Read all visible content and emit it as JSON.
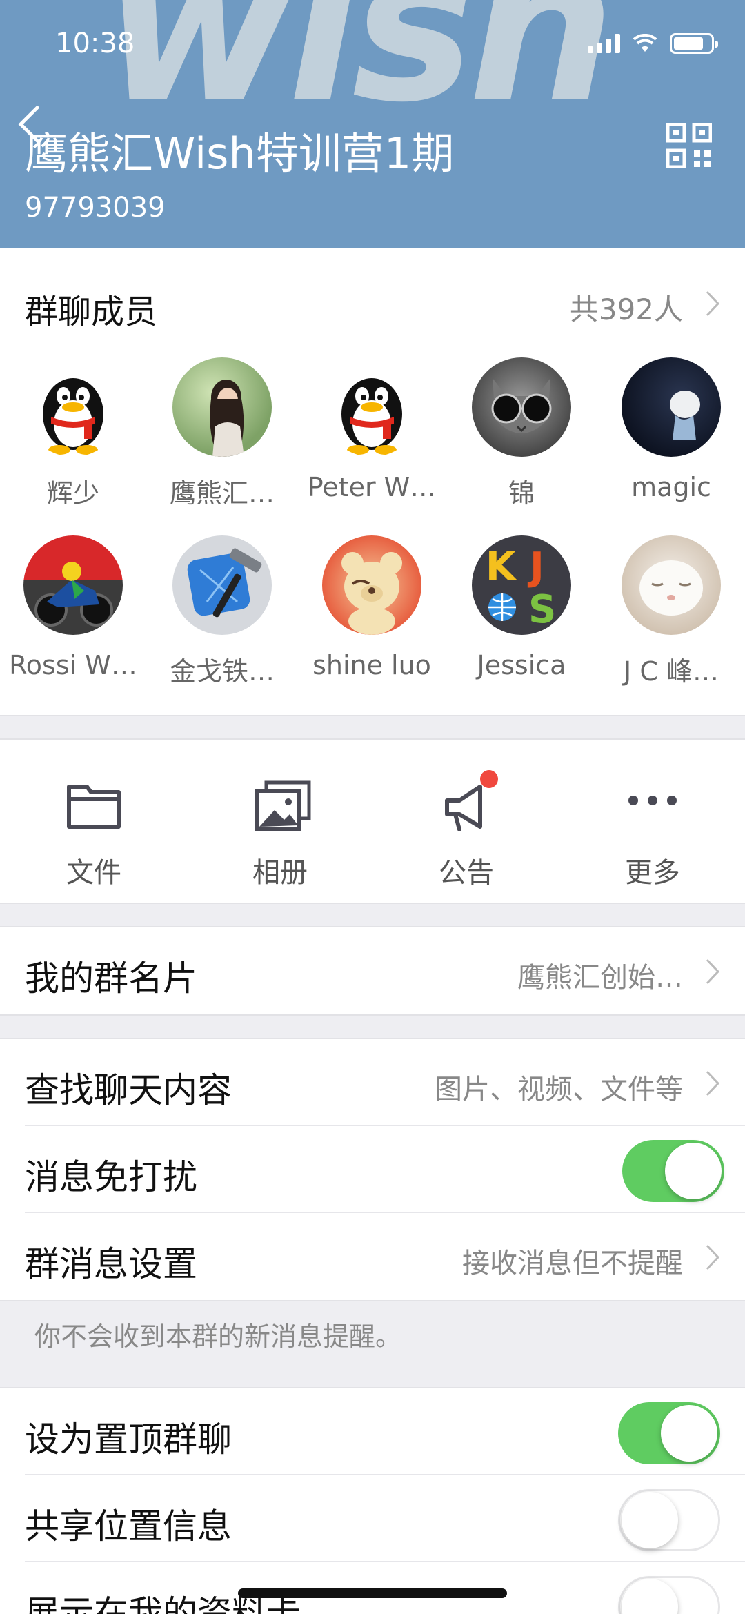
{
  "status_bar": {
    "time": "10:38"
  },
  "header": {
    "watermark": "wish",
    "title": "鹰熊汇Wish特训营1期",
    "group_id": "97793039"
  },
  "members": {
    "heading": "群聊成员",
    "count": "共392人",
    "list": [
      {
        "name": "辉少",
        "avatar": "qq-penguin"
      },
      {
        "name": "鹰熊汇…",
        "avatar": "photo-woman"
      },
      {
        "name": "Peter W…",
        "avatar": "qq-penguin"
      },
      {
        "name": "锦",
        "avatar": "cat-sunglasses"
      },
      {
        "name": "magic",
        "avatar": "photo-dark-figure"
      },
      {
        "name": "Rossi W…",
        "avatar": "motorcycle-rider"
      },
      {
        "name": "金戈铁…",
        "avatar": "xcode-hammer"
      },
      {
        "name": "shine luo",
        "avatar": "teddy-bear"
      },
      {
        "name": "Jessica",
        "avatar": "kjs-logo"
      },
      {
        "name": "J C 峰…",
        "avatar": "white-cat"
      }
    ]
  },
  "toolbar": [
    {
      "label": "文件",
      "icon": "folder-icon"
    },
    {
      "label": "相册",
      "icon": "photo-album-icon"
    },
    {
      "label": "公告",
      "icon": "megaphone-icon"
    },
    {
      "label": "更多",
      "icon": "more-dots-icon"
    }
  ],
  "settings": {
    "group_card": {
      "label": "我的群名片",
      "value": "鹰熊汇创始…"
    },
    "search_chat": {
      "label": "查找聊天内容",
      "value": "图片、视频、文件等"
    },
    "do_not_disturb": {
      "label": "消息免打扰",
      "on": true
    },
    "msg_settings": {
      "label": "群消息设置",
      "value": "接收消息但不提醒"
    },
    "hint": "你不会收到本群的新消息提醒。",
    "pin_chat": {
      "label": "设为置顶群聊",
      "on": true
    },
    "share_location": {
      "label": "共享位置信息",
      "on": false
    },
    "show_in_profile": {
      "label": "展示在我的资料卡",
      "on": false
    }
  },
  "colors": {
    "header_bg": "#6f9ac2",
    "toggle_on": "#5fcc61",
    "badge": "#f0483e"
  }
}
